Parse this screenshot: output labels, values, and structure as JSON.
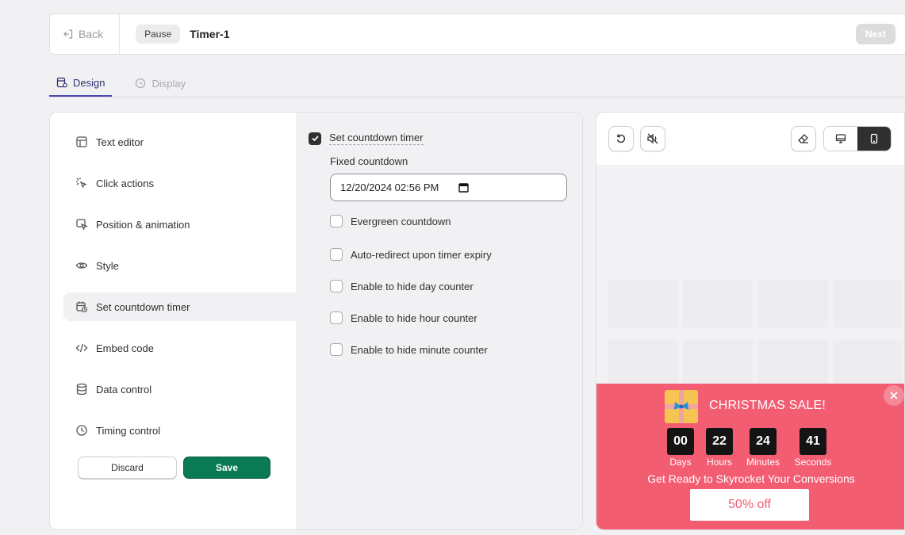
{
  "header": {
    "back_label": "Back",
    "pause_label": "Pause",
    "timer_name": "Timer-1",
    "next_label": "Next"
  },
  "tabs": [
    {
      "label": "Design",
      "active": true
    },
    {
      "label": "Display",
      "active": false
    }
  ],
  "sidebar": {
    "items": [
      {
        "label": "Text editor",
        "icon": "layout-icon"
      },
      {
        "label": "Click actions",
        "icon": "cursor-click-icon"
      },
      {
        "label": "Position & animation",
        "icon": "cursor-move-icon"
      },
      {
        "label": "Style",
        "icon": "eye-icon"
      },
      {
        "label": "Set countdown timer",
        "icon": "calendar-clock-icon",
        "active": true
      },
      {
        "label": "Embed code",
        "icon": "code-icon"
      },
      {
        "label": "Data control",
        "icon": "database-icon"
      },
      {
        "label": "Timing control",
        "icon": "clock-icon"
      }
    ],
    "discard_label": "Discard",
    "save_label": "Save",
    "save_color": "#0a7a55"
  },
  "countdown_settings": {
    "set_timer_label": "Set countdown timer",
    "set_timer_checked": true,
    "fixed_label": "Fixed countdown",
    "fixed_value": "12/20/2024 02:56 PM",
    "options": [
      {
        "label": "Evergreen countdown",
        "checked": false
      },
      {
        "label": "Auto-redirect upon timer expiry",
        "checked": false
      },
      {
        "label": "Enable to hide day counter",
        "checked": false
      },
      {
        "label": "Enable to hide hour counter",
        "checked": false
      },
      {
        "label": "Enable to hide minute counter",
        "checked": false
      }
    ]
  },
  "preview": {
    "view_mode": "mobile",
    "popup": {
      "bg_color": "#f25d72",
      "title": "CHRISTMAS SALE!",
      "counters": [
        {
          "value": "00",
          "label": "Days"
        },
        {
          "value": "22",
          "label": "Hours"
        },
        {
          "value": "24",
          "label": "Minutes"
        },
        {
          "value": "41",
          "label": "Seconds"
        }
      ],
      "tagline": "Get Ready to Skyrocket Your Conversions",
      "cta_label": "50% off"
    }
  }
}
